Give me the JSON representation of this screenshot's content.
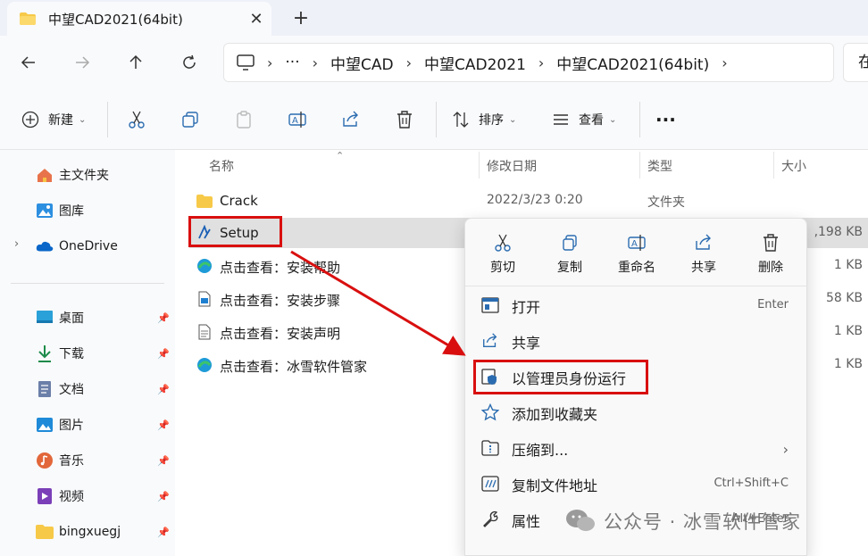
{
  "tab": {
    "title": "中望CAD2021(64bit)",
    "close": "✕",
    "new": "+"
  },
  "address": {
    "crumbs": [
      "中望CAD",
      "中望CAD2021",
      "中望CAD2021(64bit)"
    ],
    "ellipsis": "···",
    "search_placeholder": "在"
  },
  "commands": {
    "new": "新建",
    "sort": "排序",
    "view": "查看",
    "more": "···"
  },
  "sidebar": {
    "items": [
      {
        "label": "主文件夹",
        "icon": "home-icon"
      },
      {
        "label": "图库",
        "icon": "gallery-icon"
      },
      {
        "label": "OneDrive",
        "icon": "cloud-icon"
      },
      {
        "label": "桌面",
        "icon": "desktop-icon"
      },
      {
        "label": "下载",
        "icon": "download-icon"
      },
      {
        "label": "文档",
        "icon": "document-icon"
      },
      {
        "label": "图片",
        "icon": "picture-icon"
      },
      {
        "label": "音乐",
        "icon": "music-icon"
      },
      {
        "label": "视频",
        "icon": "video-icon"
      },
      {
        "label": "bingxuegj",
        "icon": "folder-icon"
      }
    ]
  },
  "columns": {
    "name": "名称",
    "modified": "修改日期",
    "type": "类型",
    "size": "大小"
  },
  "files": [
    {
      "name": "Crack",
      "date": "2022/3/23 0:20",
      "type": "文件夹",
      "size": ""
    },
    {
      "name": "Setup",
      "date": "",
      "type": "",
      "size": ",198 KB"
    },
    {
      "name": "点击查看：安装帮助",
      "date": "",
      "type": "",
      "size": "1 KB"
    },
    {
      "name": "点击查看：安装步骤",
      "date": "",
      "type": "",
      "size": "58 KB"
    },
    {
      "name": "点击查看：安装声明",
      "date": "",
      "type": "",
      "size": "1 KB"
    },
    {
      "name": "点击查看：冰雪软件管家",
      "date": "",
      "type": "",
      "size": "1 KB"
    }
  ],
  "context_menu": {
    "quick": [
      "剪切",
      "复制",
      "重命名",
      "共享",
      "删除"
    ],
    "items": [
      {
        "label": "打开",
        "shortcut": "Enter"
      },
      {
        "label": "共享",
        "shortcut": ""
      },
      {
        "label": "以管理员身份运行",
        "shortcut": ""
      },
      {
        "label": "添加到收藏夹",
        "shortcut": ""
      },
      {
        "label": "压缩到...",
        "shortcut": ""
      },
      {
        "label": "复制文件地址",
        "shortcut": "Ctrl+Shift+C"
      },
      {
        "label": "属性",
        "shortcut": "Alt+Enter"
      }
    ]
  },
  "watermark": "公众号 · 冰雪软件管家",
  "colors": {
    "highlight": "#d90f0f",
    "selection": "#e0e0e0",
    "accent": "#0067c0"
  }
}
